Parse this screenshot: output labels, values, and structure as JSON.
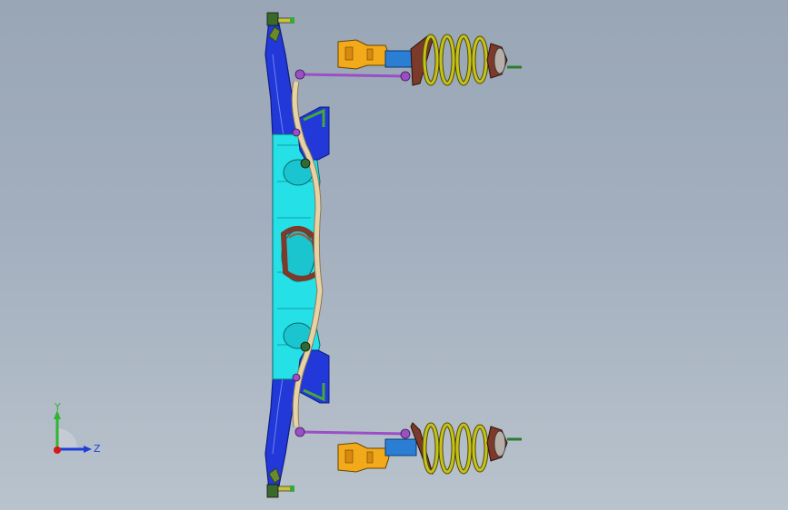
{
  "viewport": {
    "background_top": "#99a6b6",
    "background_bottom": "#b9c3cd"
  },
  "triad": {
    "y_label": "Y",
    "z_label": "Z",
    "y_color": "#2fb52f",
    "z_color": "#1f3fd6",
    "x_color": "#d21a1a"
  },
  "model": {
    "subframe_color": "#2238d8",
    "crossmember_color": "#25e0e6",
    "stabilizer_bar_color": "#e7d2a7",
    "link_color": "#9a4fc6",
    "spring_color": "#c7c21a",
    "damper_body_color": "#f2a91a",
    "damper_rod_color": "#2a7fd4",
    "bracket_color": "#45a83a",
    "mount_color": "#7b3a2a"
  }
}
